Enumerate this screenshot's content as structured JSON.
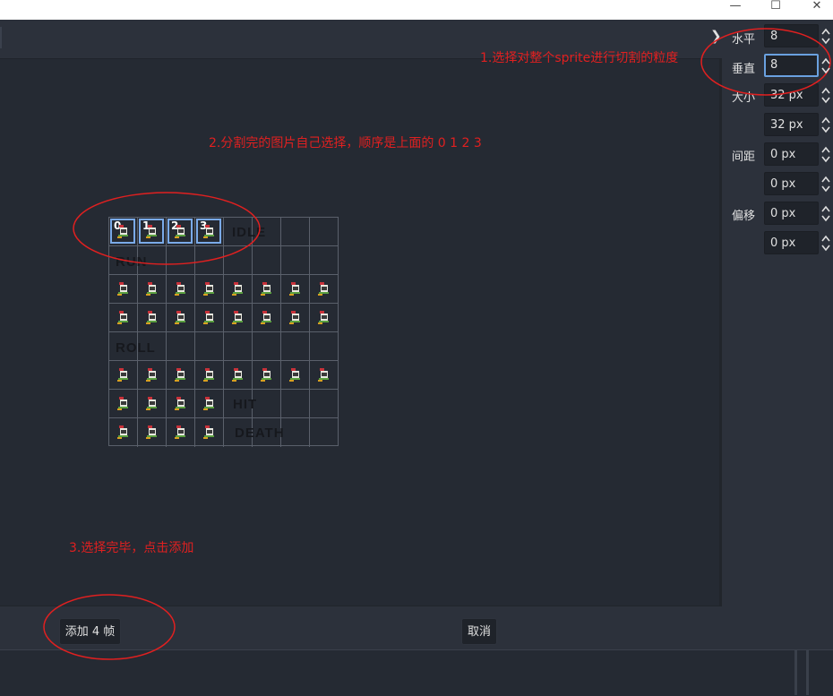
{
  "window": {
    "minimize_glyph": "—",
    "maximize_glyph": "☐",
    "close_glyph": "✕"
  },
  "toolbar": {
    "collapse_glyph": "❯"
  },
  "settings": {
    "horizontal_label": "水平",
    "horizontal_value": "8",
    "vertical_label": "垂直",
    "vertical_value": "8",
    "size_label": "大小",
    "size_x": "32 px",
    "size_y": "32 px",
    "separation_label": "间距",
    "separation_x": "0 px",
    "separation_y": "0 px",
    "offset_label": "偏移",
    "offset_x": "0 px",
    "offset_y": "0 px"
  },
  "sheet": {
    "labels": {
      "idle": "IDLE",
      "run": "RUN",
      "roll": "ROLL",
      "hit": "HIT",
      "death": "DEATH"
    },
    "selected_frames": [
      "0",
      "1",
      "2",
      "3"
    ]
  },
  "annotations": {
    "note1": "1.选择对整个sprite进行切割的粒度",
    "note2": "2.分割完的图片自己选择，顺序是上面的 0 1 2 3",
    "note3": "3.选择完毕，点击添加"
  },
  "footer": {
    "add_button": "添加 4 帧",
    "cancel_button": "取消"
  },
  "colors": {
    "annotation": "#e02020",
    "selection": "#7aaae8",
    "panel": "#2c313b",
    "canvas": "#252a33"
  }
}
